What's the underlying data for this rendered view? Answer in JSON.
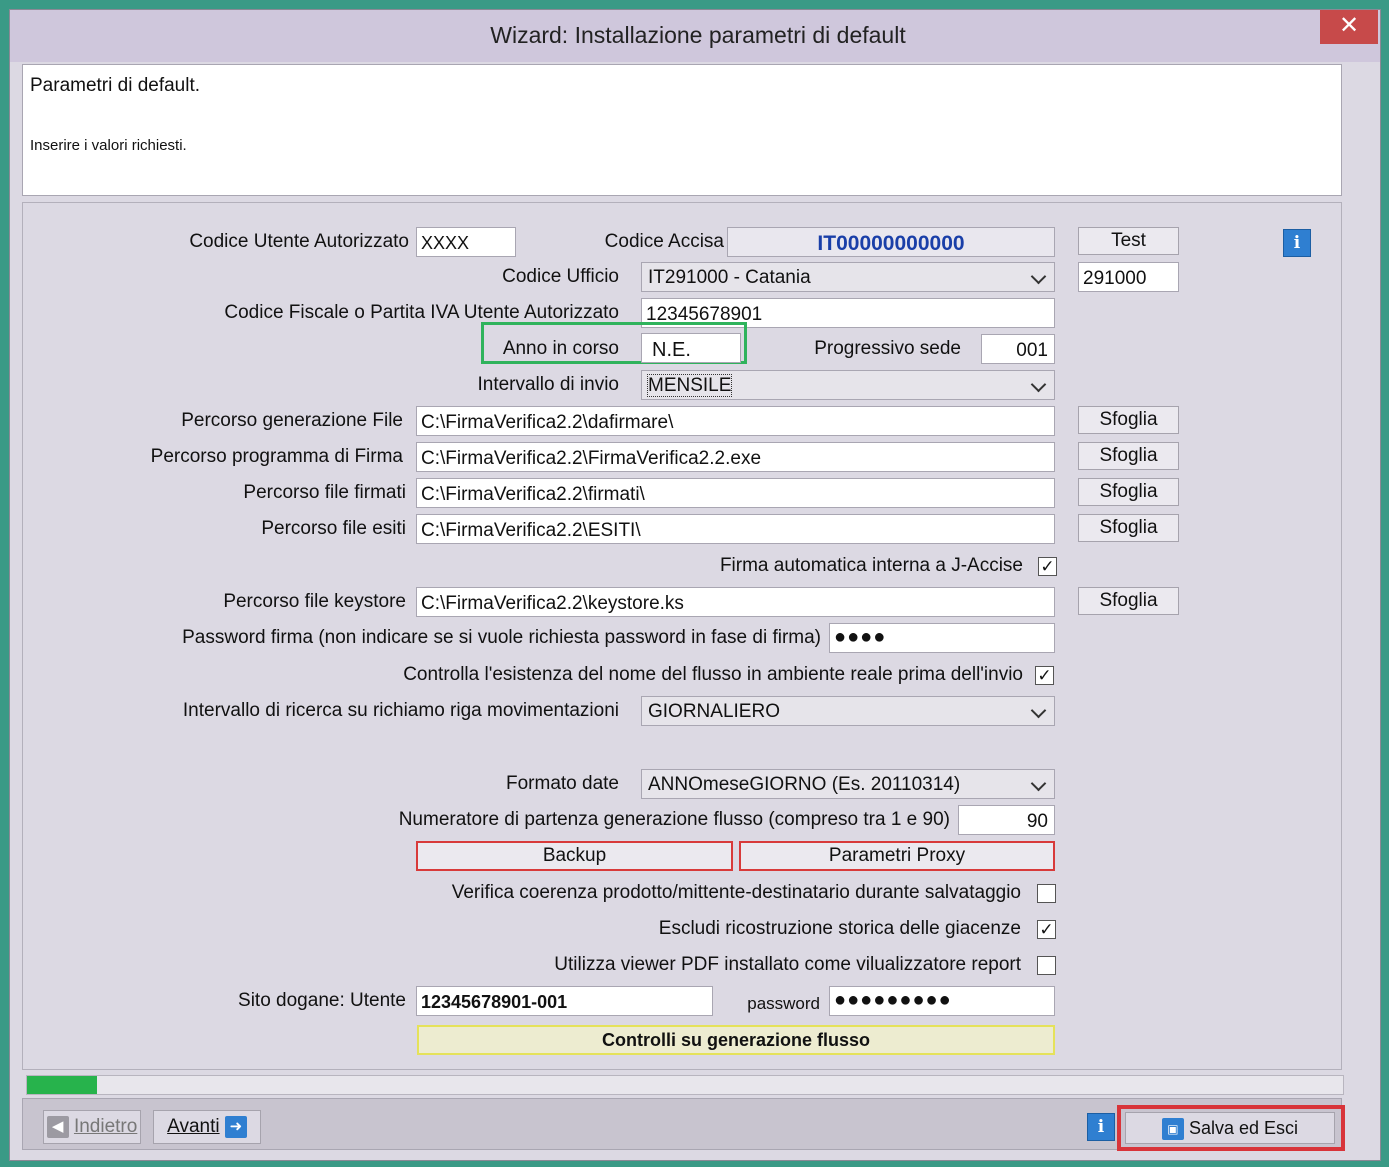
{
  "window": {
    "title": "Wizard: Installazione parametri di default",
    "close": "✕"
  },
  "header": {
    "title": "Parametri di default.",
    "subtitle": "Inserire i valori richiesti."
  },
  "form": {
    "codice_utente": {
      "label": "Codice Utente Autorizzato",
      "value": "XXXX"
    },
    "codice_accisa": {
      "label": "Codice Accisa",
      "value": "IT00000000000"
    },
    "test_button": "Test",
    "codice_ufficio": {
      "label": "Codice Ufficio",
      "value": "IT291000 - Catania",
      "code": "291000"
    },
    "codice_fiscale": {
      "label": "Codice Fiscale o Partita IVA Utente Autorizzato",
      "value": "12345678901"
    },
    "anno": {
      "label": "Anno in corso",
      "value": "N.E."
    },
    "progressivo": {
      "label": "Progressivo sede",
      "value": "001"
    },
    "intervallo_invio": {
      "label": "Intervallo di invio",
      "value": "MENSILE"
    },
    "browse_label": "Sfoglia",
    "paths": [
      {
        "label": "Percorso generazione File",
        "value": "C:\\FirmaVerifica2.2\\dafirmare\\"
      },
      {
        "label": "Percorso programma di Firma",
        "value": "C:\\FirmaVerifica2.2\\FirmaVerifica2.2.exe"
      },
      {
        "label": "Percorso file firmati",
        "value": "C:\\FirmaVerifica2.2\\firmati\\"
      },
      {
        "label": "Percorso file esiti",
        "value": "C:\\FirmaVerifica2.2\\ESITI\\"
      }
    ],
    "firma_auto": {
      "label": "Firma automatica interna a J-Accise",
      "checked": true
    },
    "keystore": {
      "label": "Percorso file keystore",
      "value": "C:\\FirmaVerifica2.2\\keystore.ks"
    },
    "password_firma": {
      "label": "Password firma (non indicare se si vuole richiesta password in fase di firma)",
      "value": "●●●●"
    },
    "controlla": {
      "label": "Controlla l'esistenza del nome del flusso in ambiente reale prima dell'invio",
      "checked": true
    },
    "intervallo_ricerca": {
      "label": "Intervallo di ricerca su richiamo riga movimentazioni",
      "value": "GIORNALIERO"
    },
    "formato_date": {
      "label": "Formato date",
      "value": "ANNOmeseGIORNO (Es. 20110314)"
    },
    "numeratore": {
      "label": "Numeratore di partenza generazione flusso (compreso tra 1 e 90)",
      "value": "90"
    },
    "backup_button": "Backup",
    "proxy_button": "Parametri Proxy",
    "verifica": {
      "label": "Verifica coerenza prodotto/mittente-destinatario durante salvataggio",
      "checked": false
    },
    "escludi": {
      "label": "Escludi ricostruzione storica delle giacenze",
      "checked": true
    },
    "viewer": {
      "label": "Utilizza viewer PDF installato come vilualizzatore report",
      "checked": false
    },
    "sito": {
      "label": "Sito dogane: Utente",
      "value": "12345678901-001",
      "password_label": "password",
      "password_value": "●●●●●●●●●"
    },
    "controlli_button": "Controlli su generazione flusso",
    "check_mark": "✓"
  },
  "progress": {
    "fraction": 0.053
  },
  "footer": {
    "back": "Indietro",
    "next": "Avanti",
    "save": "Salva ed Esci"
  },
  "icons": {
    "info": "info-icon",
    "back": "arrow-left-icon",
    "next": "arrow-right-icon",
    "save": "save-icon"
  },
  "colors": {
    "highlight_green": "#2fb35c",
    "highlight_red": "#d8343a",
    "accisa_text": "#1a3fa8"
  }
}
